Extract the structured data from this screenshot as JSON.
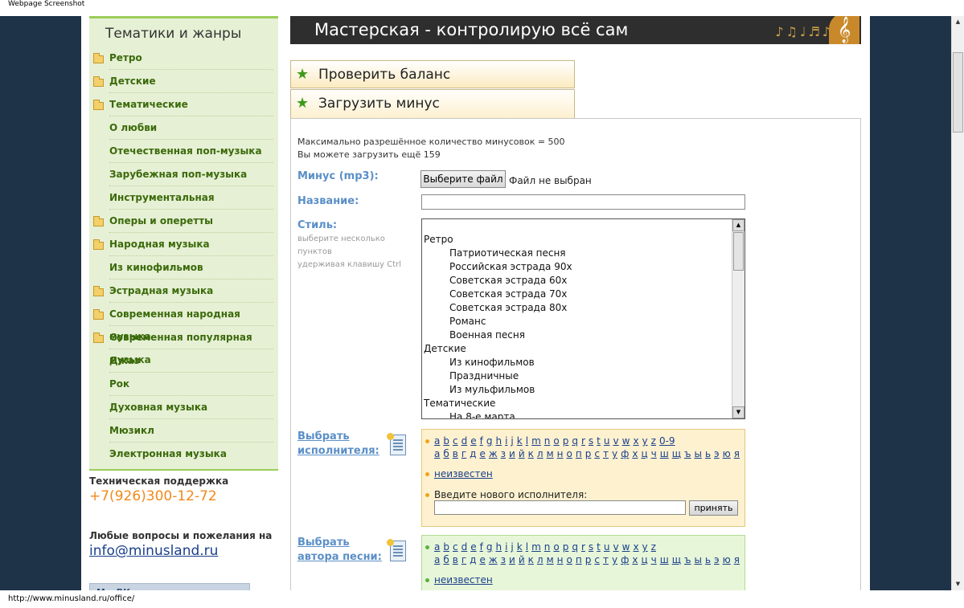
{
  "window": {
    "title": "Webpage Screenshot"
  },
  "sidebar": {
    "title": "Тематики и жанры",
    "items": [
      {
        "label": "Ретро",
        "folder": true
      },
      {
        "label": "Детские",
        "folder": true
      },
      {
        "label": "Тематические",
        "folder": true
      },
      {
        "label": "О любви",
        "folder": false
      },
      {
        "label": "Отечественная поп-музыка",
        "folder": false
      },
      {
        "label": "Зарубежная поп-музыка",
        "folder": false
      },
      {
        "label": "Инструментальная",
        "folder": false
      },
      {
        "label": "Оперы и оперетты",
        "folder": true
      },
      {
        "label": "Народная музыка",
        "folder": true
      },
      {
        "label": "Из кинофильмов",
        "folder": false
      },
      {
        "label": "Эстрадная музыка",
        "folder": true
      },
      {
        "label": "Современная народная музыка",
        "folder": true
      },
      {
        "label": "Современная популярная музыка",
        "folder": true
      },
      {
        "label": "Джаз",
        "folder": false
      },
      {
        "label": "Рок",
        "folder": false
      },
      {
        "label": "Духовная музыка",
        "folder": false
      },
      {
        "label": "Мюзикл",
        "folder": false
      },
      {
        "label": "Электронная музыка",
        "folder": false
      }
    ],
    "support_title": "Техническая поддержка",
    "phone": "+7(926)300-12-72",
    "questions_title": "Любые вопросы и пожелания на",
    "email": "info@minusland.ru",
    "vk_label": "Мы ВКонтакте"
  },
  "banner": {
    "title": "Мастерская - контролирую всё сам"
  },
  "tabs": {
    "check_balance": "Проверить баланс",
    "upload_minus": "Загрузить минус"
  },
  "form": {
    "max_info": "Максимально разрешённое количество минусовок = 500",
    "remaining_info": "Вы можете загрузить ещё 159",
    "file_label": "Минус (mp3):",
    "file_button": "Выберите файл",
    "file_status": "Файл не выбран",
    "name_label": "Название:",
    "name_value": "",
    "style_label": "Стиль:",
    "style_hint1": "выберите несколько",
    "style_hint2": "пунктов",
    "style_hint3": "удерживая клавишу Ctrl",
    "style_options": [
      {
        "label": "Ретро",
        "sub": false
      },
      {
        "label": "Патриотическая песня",
        "sub": true
      },
      {
        "label": "Российская эстрада 90х",
        "sub": true
      },
      {
        "label": "Советская эстрада 60х",
        "sub": true
      },
      {
        "label": "Советская эстрада 70х",
        "sub": true
      },
      {
        "label": "Советская эстрада 80х",
        "sub": true
      },
      {
        "label": "Романс",
        "sub": true
      },
      {
        "label": "Военная песня",
        "sub": true
      },
      {
        "label": "Детские",
        "sub": false
      },
      {
        "label": "Из кинофильмов",
        "sub": true
      },
      {
        "label": "Праздничные",
        "sub": true
      },
      {
        "label": "Из мульфильмов",
        "sub": true
      },
      {
        "label": "Тематические",
        "sub": false
      },
      {
        "label": "На 8-е марта",
        "sub": true
      }
    ],
    "artist": {
      "label_line1": "Выбрать",
      "label_line2": "исполнителя:",
      "latin": [
        "a",
        "b",
        "c",
        "d",
        "e",
        "f",
        "g",
        "h",
        "i",
        "j",
        "k",
        "l",
        "m",
        "n",
        "o",
        "p",
        "q",
        "r",
        "s",
        "t",
        "u",
        "v",
        "w",
        "x",
        "y",
        "z",
        "0-9"
      ],
      "cyrillic": [
        "а",
        "б",
        "в",
        "г",
        "д",
        "е",
        "ж",
        "з",
        "и",
        "й",
        "к",
        "л",
        "м",
        "н",
        "о",
        "п",
        "р",
        "с",
        "т",
        "у",
        "ф",
        "х",
        "ц",
        "ч",
        "ш",
        "щ",
        "ъ",
        "ы",
        "ь",
        "э",
        "ю",
        "я"
      ],
      "unknown": "неизвестен",
      "new_label": "Введите нового исполнителя:",
      "new_value": "",
      "accept_button": "принять"
    },
    "author": {
      "label_line1": "Выбрать",
      "label_line2": "автора песни:",
      "latin": [
        "a",
        "b",
        "c",
        "d",
        "e",
        "f",
        "g",
        "h",
        "i",
        "j",
        "k",
        "l",
        "m",
        "n",
        "o",
        "p",
        "q",
        "r",
        "s",
        "t",
        "u",
        "v",
        "w",
        "x",
        "y",
        "z"
      ],
      "cyrillic": [
        "а",
        "б",
        "в",
        "г",
        "д",
        "е",
        "ж",
        "з",
        "и",
        "й",
        "к",
        "л",
        "м",
        "н",
        "о",
        "п",
        "р",
        "с",
        "т",
        "у",
        "ф",
        "х",
        "ц",
        "ч",
        "ш",
        "щ",
        "ъ",
        "ы",
        "ь",
        "э",
        "ю",
        "я"
      ],
      "unknown": "неизвестен"
    }
  },
  "status_bar": {
    "url": "http://www.minusland.ru/office/"
  },
  "colors": {
    "page_bg": "#1e3347",
    "sidebar_bg": "#e6f0d5",
    "accent_green": "#9acd5a",
    "link": "#1a3f8c",
    "phone": "#f2891a"
  }
}
